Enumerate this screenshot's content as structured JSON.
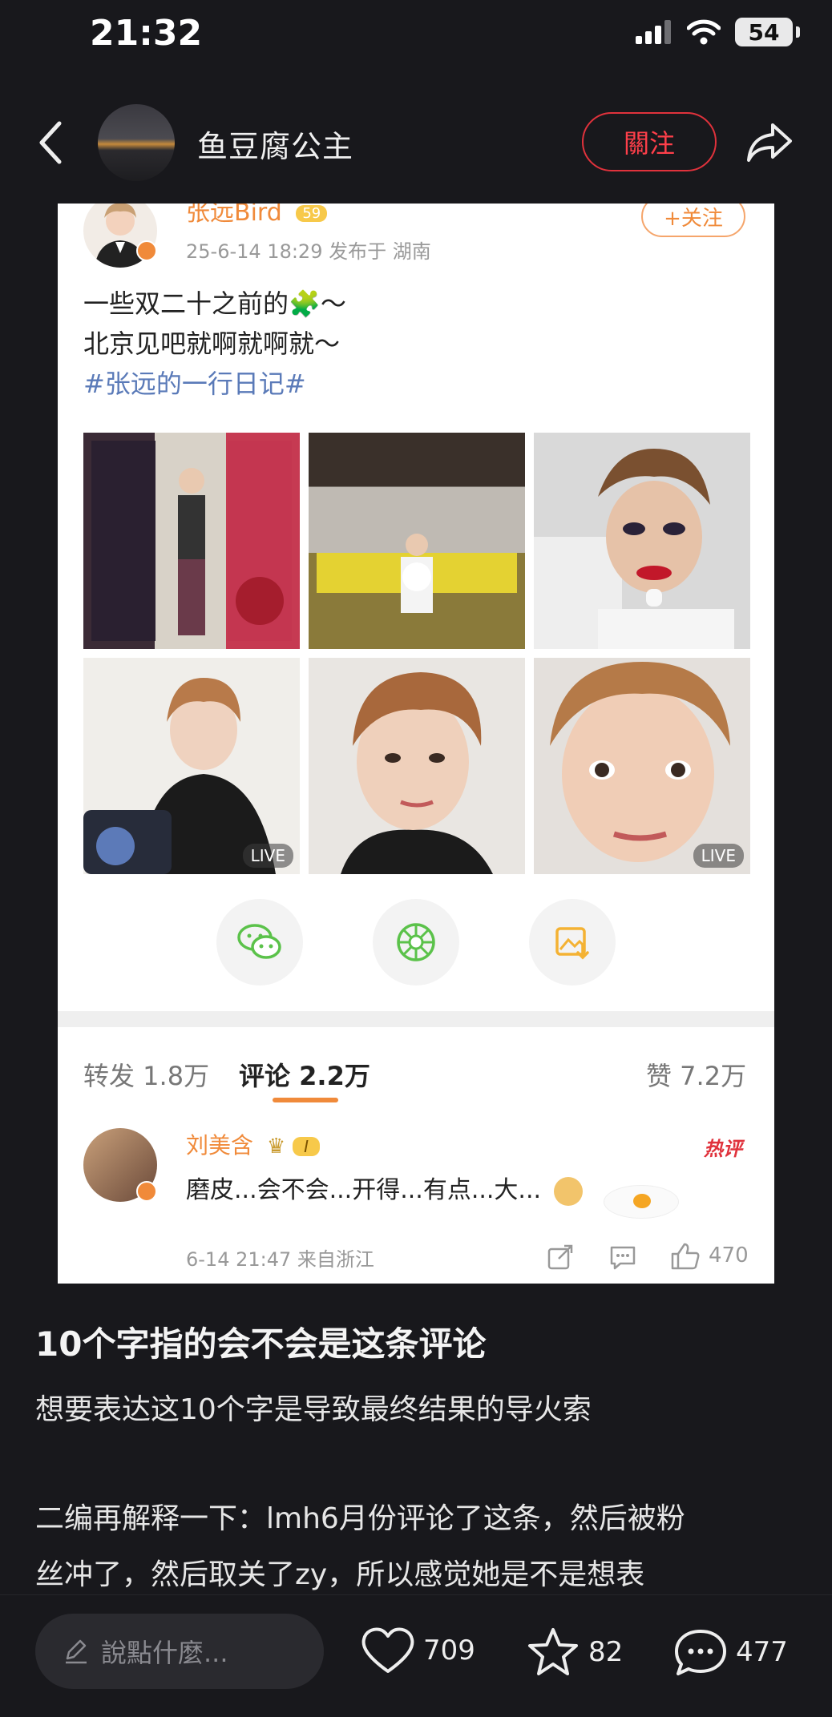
{
  "status": {
    "time": "21:32",
    "battery": "54"
  },
  "header": {
    "title": "鱼豆腐公主",
    "follow_label": "關注"
  },
  "card": {
    "username": "张远Bird",
    "level": "59",
    "time_location": "25-6-14 18:29  发布于 湖南",
    "follow_label": "+关注",
    "text_line1": "一些双二十之前的🧩～",
    "text_line2": "北京见吧就啊就啊就～",
    "hashtag": "#张远的一行日记#",
    "live_label": "LIVE",
    "tabs": {
      "repost": "转发 1.8万",
      "comment": "评论 2.2万",
      "like": "赞 7.2万"
    },
    "comment": {
      "name": "刘美含",
      "badge": "I",
      "hot": "热评",
      "text": "磨皮...会不会...开得...有点...大...",
      "meta": "6-14 21:47  来自浙江",
      "likes": "470"
    }
  },
  "post": {
    "title": "10个字指的会不会是这条评论",
    "line1": "想要表达这10个字是导致最终结果的导火索",
    "line2": "二编再解释一下：lmh6月份评论了这条，然后被粉",
    "line3": "丝冲了，然后取关了zy，所以感觉她是不是想表"
  },
  "bottom": {
    "placeholder": "說點什麼...",
    "likes": "709",
    "favorites": "82",
    "comments": "477"
  },
  "colors": {
    "accent_red": "#e0323c",
    "weibo_orange": "#f08a3a",
    "bg": "#18181c"
  }
}
